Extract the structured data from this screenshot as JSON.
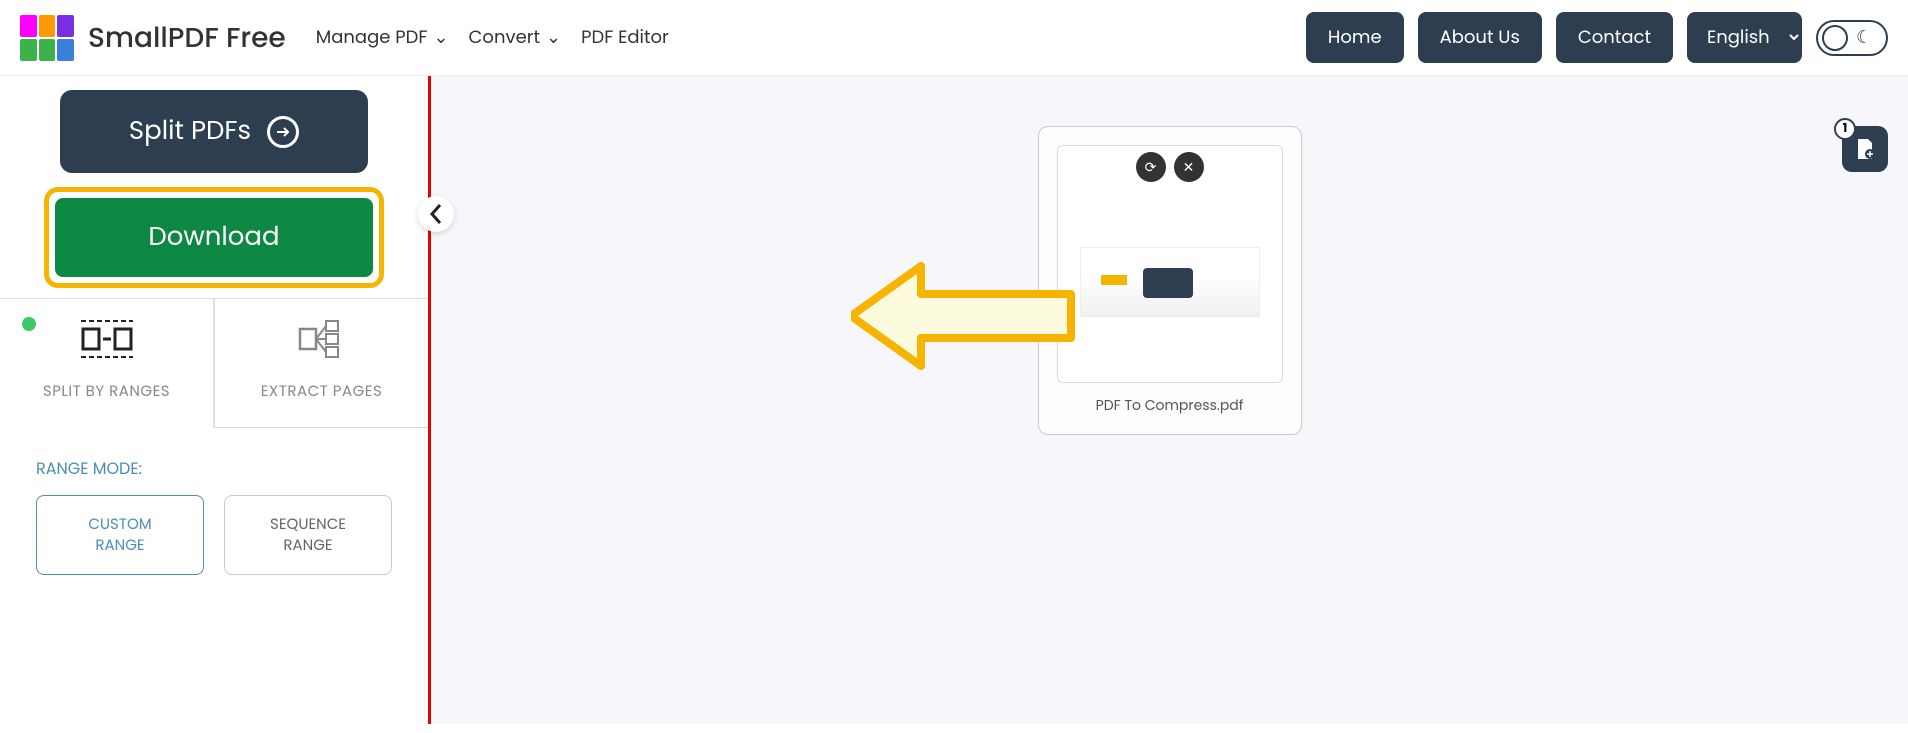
{
  "header": {
    "brand": "SmallPDF Free",
    "nav_left": [
      {
        "label": "Manage PDF",
        "dropdown": true
      },
      {
        "label": "Convert",
        "dropdown": true
      },
      {
        "label": "PDF Editor",
        "dropdown": false
      }
    ],
    "nav_right": {
      "home": "Home",
      "about": "About Us",
      "contact": "Contact",
      "language": "English"
    },
    "logo_colors": [
      "#ff00ff",
      "#ff9900",
      "#7b2fe3",
      "#3bb34a",
      "#3bb34a",
      "#3b7fdd"
    ]
  },
  "sidebar": {
    "split_label": "Split PDFs",
    "download_label": "Download",
    "tabs": [
      {
        "label": "SPLIT BY RANGES"
      },
      {
        "label": "EXTRACT PAGES"
      }
    ],
    "range_title": "RANGE MODE:",
    "range_buttons": [
      {
        "line1": "CUSTOM",
        "line2": "RANGE"
      },
      {
        "line1": "SEQUENCE",
        "line2": "RANGE"
      }
    ]
  },
  "content": {
    "file_name": "PDF To Compress.pdf",
    "file_count": "1"
  }
}
